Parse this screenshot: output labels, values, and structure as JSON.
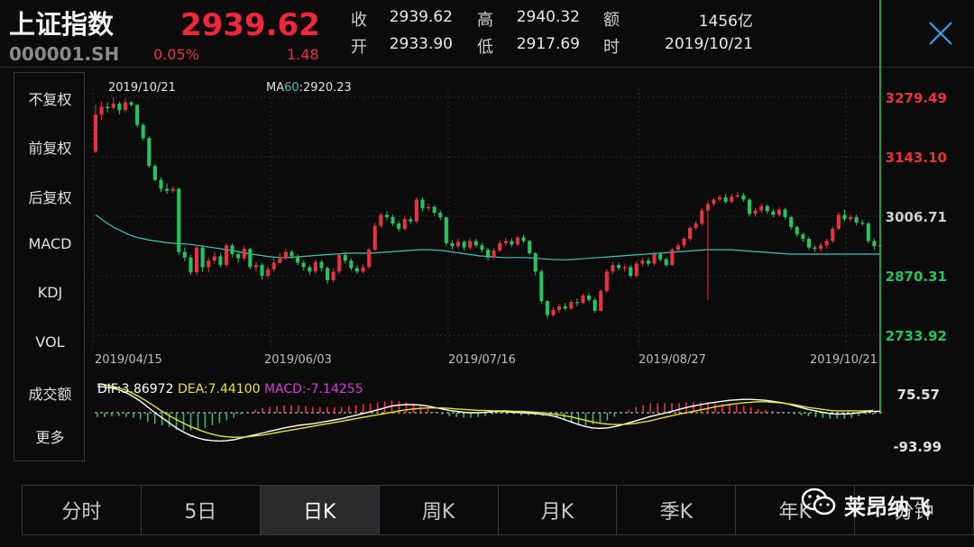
{
  "header": {
    "name": "上证指数",
    "code": "000001.SH",
    "price": "2939.62",
    "change_pct": "0.05%",
    "change": "1.48",
    "quotes": [
      {
        "label": "收",
        "value": "2939.62"
      },
      {
        "label": "高",
        "value": "2940.32"
      },
      {
        "label": "额",
        "value": "1456亿"
      },
      {
        "label": "开",
        "value": "2933.90"
      },
      {
        "label": "低",
        "value": "2917.69"
      },
      {
        "label": "时",
        "value": "2019/10/21"
      }
    ]
  },
  "sidebar": {
    "items": [
      {
        "label": "不复权",
        "active": true
      },
      {
        "label": "前复权",
        "active": false
      },
      {
        "label": "后复权",
        "active": false
      },
      {
        "label": "MACD",
        "active": true
      },
      {
        "label": "KDJ",
        "active": false
      },
      {
        "label": "VOL",
        "active": false
      },
      {
        "label": "成交额",
        "active": false
      },
      {
        "label": "更多",
        "active": false
      }
    ]
  },
  "tabs": [
    {
      "label": "分时",
      "active": false
    },
    {
      "label": "5日",
      "active": false
    },
    {
      "label": "日K",
      "active": true
    },
    {
      "label": "周K",
      "active": false
    },
    {
      "label": "月K",
      "active": false
    },
    {
      "label": "季K",
      "active": false
    },
    {
      "label": "年K",
      "active": false
    },
    {
      "label": "分钟",
      "active": false
    }
  ],
  "watermark": {
    "text": "莱昂纳飞",
    "icon": "wechat-icon"
  },
  "colors": {
    "up": "#e8333f",
    "down": "#22c55e",
    "ma": "#40c8b8",
    "dif": "#ffffff",
    "dea": "#e6e62a",
    "macd": "#d63cd6",
    "accent": "#3aa0ff"
  },
  "chart_data": [
    {
      "type": "candlestick",
      "title": "",
      "top_left_date": "2019/10/21",
      "ma_label_prefix": "MA",
      "ma_period": "60",
      "ma_value": ":2920.23",
      "y_ticks": [
        "3279.49",
        "3143.10",
        "3006.71",
        "2870.31",
        "2733.92"
      ],
      "ylim": [
        2733.92,
        3279.49
      ],
      "x_ticks": [
        "2019/04/15",
        "2019/06/03",
        "2019/07/16",
        "2019/08/27",
        "2019/10/21"
      ],
      "candles": [
        [
          3155,
          3240,
          3262,
          3152
        ],
        [
          3240,
          3258,
          3270,
          3228
        ],
        [
          3258,
          3255,
          3268,
          3245
        ],
        [
          3255,
          3265,
          3280,
          3252
        ],
        [
          3265,
          3250,
          3270,
          3240
        ],
        [
          3250,
          3268,
          3278,
          3245
        ],
        [
          3268,
          3262,
          3272,
          3258
        ],
        [
          3262,
          3216,
          3264,
          3210
        ],
        [
          3216,
          3186,
          3220,
          3180
        ],
        [
          3186,
          3122,
          3190,
          3118
        ],
        [
          3122,
          3090,
          3126,
          3086
        ],
        [
          3090,
          3070,
          3096,
          3062
        ],
        [
          3070,
          3065,
          3082,
          3058
        ],
        [
          3065,
          3070,
          3076,
          3060
        ],
        [
          3070,
          2925,
          3072,
          2918
        ],
        [
          2925,
          2912,
          2935,
          2904
        ],
        [
          2912,
          2878,
          2918,
          2872
        ],
        [
          2878,
          2935,
          2942,
          2872
        ],
        [
          2935,
          2890,
          2940,
          2880
        ],
        [
          2890,
          2905,
          2912,
          2878
        ],
        [
          2905,
          2915,
          2925,
          2898
        ],
        [
          2915,
          2895,
          2922,
          2890
        ],
        [
          2895,
          2940,
          2945,
          2890
        ],
        [
          2940,
          2920,
          2945,
          2912
        ],
        [
          2920,
          2910,
          2928,
          2900
        ],
        [
          2910,
          2932,
          2940,
          2905
        ],
        [
          2932,
          2890,
          2935,
          2885
        ],
        [
          2890,
          2895,
          2902,
          2880
        ],
        [
          2895,
          2870,
          2900,
          2862
        ],
        [
          2870,
          2885,
          2892,
          2865
        ],
        [
          2885,
          2900,
          2912,
          2880
        ],
        [
          2900,
          2910,
          2922,
          2898
        ],
        [
          2910,
          2925,
          2932,
          2905
        ],
        [
          2925,
          2915,
          2930,
          2908
        ],
        [
          2915,
          2900,
          2920,
          2894
        ],
        [
          2900,
          2890,
          2906,
          2882
        ],
        [
          2890,
          2880,
          2895,
          2872
        ],
        [
          2880,
          2902,
          2908,
          2875
        ],
        [
          2902,
          2888,
          2906,
          2880
        ],
        [
          2888,
          2860,
          2892,
          2852
        ],
        [
          2860,
          2880,
          2888,
          2855
        ],
        [
          2880,
          2918,
          2922,
          2875
        ],
        [
          2918,
          2905,
          2925,
          2898
        ],
        [
          2905,
          2888,
          2910,
          2882
        ],
        [
          2888,
          2880,
          2895,
          2875
        ],
        [
          2880,
          2890,
          2896,
          2876
        ],
        [
          2890,
          2930,
          2935,
          2886
        ],
        [
          2930,
          2985,
          2992,
          2926
        ],
        [
          2985,
          3010,
          3015,
          2980
        ],
        [
          3010,
          3005,
          3018,
          2998
        ],
        [
          3005,
          2990,
          3010,
          2985
        ],
        [
          2990,
          2978,
          2996,
          2972
        ],
        [
          2978,
          3000,
          3008,
          2974
        ],
        [
          3000,
          2995,
          3006,
          2988
        ],
        [
          2995,
          3045,
          3050,
          2990
        ],
        [
          3045,
          3025,
          3050,
          3018
        ],
        [
          3025,
          3028,
          3036,
          3018
        ],
        [
          3028,
          3015,
          3032,
          3008
        ],
        [
          3015,
          3004,
          3020,
          2998
        ],
        [
          3004,
          2945,
          3006,
          2938
        ],
        [
          2945,
          2938,
          2952,
          2930
        ],
        [
          2938,
          2948,
          2955,
          2932
        ],
        [
          2948,
          2935,
          2952,
          2928
        ],
        [
          2935,
          2950,
          2958,
          2930
        ],
        [
          2950,
          2940,
          2955,
          2935
        ],
        [
          2940,
          2930,
          2946,
          2924
        ],
        [
          2930,
          2912,
          2935,
          2905
        ],
        [
          2912,
          2928,
          2934,
          2908
        ],
        [
          2928,
          2945,
          2950,
          2925
        ],
        [
          2945,
          2950,
          2958,
          2940
        ],
        [
          2950,
          2942,
          2956,
          2936
        ],
        [
          2942,
          2958,
          2962,
          2938
        ],
        [
          2958,
          2950,
          2964,
          2945
        ],
        [
          2950,
          2922,
          2953,
          2918
        ],
        [
          2922,
          2880,
          2925,
          2872
        ],
        [
          2880,
          2812,
          2885,
          2805
        ],
        [
          2812,
          2780,
          2815,
          2772
        ],
        [
          2780,
          2792,
          2798,
          2775
        ],
        [
          2792,
          2800,
          2806,
          2785
        ],
        [
          2800,
          2795,
          2808,
          2790
        ],
        [
          2795,
          2810,
          2815,
          2792
        ],
        [
          2810,
          2808,
          2818,
          2800
        ],
        [
          2808,
          2825,
          2830,
          2805
        ],
        [
          2825,
          2815,
          2832,
          2810
        ],
        [
          2815,
          2790,
          2820,
          2785
        ],
        [
          2790,
          2835,
          2840,
          2788
        ],
        [
          2835,
          2880,
          2886,
          2832
        ],
        [
          2880,
          2895,
          2902,
          2875
        ],
        [
          2895,
          2888,
          2900,
          2882
        ],
        [
          2888,
          2890,
          2896,
          2880
        ],
        [
          2890,
          2870,
          2895,
          2865
        ],
        [
          2870,
          2898,
          2904,
          2866
        ],
        [
          2898,
          2905,
          2912,
          2892
        ],
        [
          2905,
          2898,
          2912,
          2892
        ],
        [
          2898,
          2920,
          2926,
          2894
        ],
        [
          2920,
          2908,
          2925,
          2902
        ],
        [
          2908,
          2895,
          2912,
          2890
        ],
        [
          2895,
          2930,
          2935,
          2892
        ],
        [
          2930,
          2940,
          2946,
          2925
        ],
        [
          2940,
          2955,
          2960,
          2935
        ],
        [
          2955,
          2980,
          2985,
          2950
        ],
        [
          2980,
          2990,
          2996,
          2975
        ],
        [
          2990,
          3020,
          3026,
          2985
        ],
        [
          3020,
          3035,
          3042,
          2815
        ],
        [
          3035,
          3045,
          3050,
          3030
        ],
        [
          3045,
          3050,
          3056,
          3040
        ],
        [
          3050,
          3040,
          3058,
          3036
        ],
        [
          3040,
          3052,
          3058,
          3036
        ],
        [
          3052,
          3055,
          3062,
          3048
        ],
        [
          3055,
          3045,
          3060,
          3040
        ],
        [
          3045,
          3012,
          3048,
          3006
        ],
        [
          3012,
          3020,
          3026,
          3006
        ],
        [
          3020,
          3030,
          3036,
          3014
        ],
        [
          3030,
          3018,
          3034,
          3012
        ],
        [
          3018,
          3010,
          3024,
          3004
        ],
        [
          3010,
          3022,
          3028,
          3006
        ],
        [
          3022,
          3005,
          3026,
          3000
        ],
        [
          3005,
          2982,
          3008,
          2976
        ],
        [
          2982,
          2965,
          2986,
          2958
        ],
        [
          2965,
          2955,
          2970,
          2948
        ],
        [
          2955,
          2935,
          2960,
          2930
        ],
        [
          2935,
          2932,
          2940,
          2925
        ],
        [
          2932,
          2940,
          2946,
          2925
        ],
        [
          2940,
          2950,
          2955,
          2932
        ],
        [
          2950,
          2978,
          2984,
          2946
        ],
        [
          2978,
          3010,
          3016,
          2974
        ],
        [
          3010,
          3000,
          3022,
          2995
        ],
        [
          3000,
          3005,
          3010,
          2994
        ],
        [
          3005,
          2992,
          3010,
          2986
        ],
        [
          2992,
          2990,
          2998,
          2985
        ],
        [
          2990,
          2950,
          2994,
          2944
        ],
        [
          2950,
          2938,
          2956,
          2930
        ],
        [
          2938,
          2940,
          2948,
          2932
        ]
      ],
      "ma": [
        3010,
        3000,
        2990,
        2982,
        2975,
        2968,
        2962,
        2958,
        2955,
        2952,
        2950,
        2948,
        2946,
        2945,
        2944,
        2943,
        2942,
        2940,
        2938,
        2936,
        2934,
        2932,
        2930,
        2928,
        2925,
        2922,
        2920,
        2918,
        2916,
        2914,
        2913,
        2912,
        2912,
        2913,
        2914,
        2915,
        2916,
        2917,
        2918,
        2919,
        2920,
        2921,
        2922,
        2922,
        2922,
        2922,
        2922,
        2923,
        2924,
        2925,
        2926,
        2927,
        2928,
        2929,
        2930,
        2930,
        2930,
        2929,
        2928,
        2926,
        2924,
        2922,
        2920,
        2918,
        2916,
        2915,
        2914,
        2913,
        2912,
        2912,
        2912,
        2912,
        2912,
        2911,
        2910,
        2909,
        2908,
        2907,
        2907,
        2907,
        2908,
        2909,
        2910,
        2911,
        2912,
        2913,
        2914,
        2915,
        2916,
        2917,
        2918,
        2919,
        2920,
        2921,
        2922,
        2923,
        2924,
        2925,
        2926,
        2927,
        2928,
        2929,
        2930,
        2930,
        2930,
        2930,
        2930,
        2929,
        2928,
        2927,
        2926,
        2925,
        2924,
        2923,
        2922,
        2921,
        2920,
        2920,
        2920,
        2920,
        2920,
        2920,
        2920,
        2920,
        2920,
        2920,
        2920,
        2920,
        2920,
        2920,
        2920,
        2920
      ],
      "ma_color": "#40c8b8"
    },
    {
      "type": "macd",
      "dif_label": "DIF:3.86972",
      "dea_label": "DEA:7.44100",
      "macd_label": "MACD:-7.14255",
      "y_ticks": [
        "75.57",
        "-93.99"
      ],
      "ylim": [
        -93.99,
        75.57
      ],
      "dif": [
        55,
        54,
        52,
        48,
        42,
        34,
        24,
        12,
        0,
        -12,
        -24,
        -36,
        -46,
        -54,
        -60,
        -64,
        -66,
        -67,
        -66,
        -64,
        -60,
        -56,
        -52,
        -48,
        -44,
        -40,
        -36,
        -33,
        -30,
        -28,
        -26,
        -23,
        -20,
        -17,
        -14,
        -10,
        -6,
        -2,
        2,
        6,
        10,
        14,
        16,
        17,
        17,
        16,
        14,
        11,
        8,
        5,
        3,
        1,
        0,
        0,
        1,
        2,
        3,
        2,
        1,
        0,
        -1,
        -2,
        -4,
        -6,
        -10,
        -16,
        -22,
        -28,
        -33,
        -36,
        -37,
        -36,
        -33,
        -29,
        -24,
        -19,
        -14,
        -9,
        -5,
        -1,
        3,
        7,
        11,
        14,
        17,
        20,
        22,
        24,
        26,
        27,
        28,
        28,
        27,
        26,
        24,
        22,
        19,
        15,
        11,
        7,
        4,
        1,
        -2,
        -3,
        -3,
        -2,
        0,
        2,
        3,
        3
      ],
      "dea": [
        60,
        59,
        56,
        52,
        47,
        40,
        32,
        23,
        13,
        3,
        -7,
        -16,
        -25,
        -33,
        -40,
        -46,
        -51,
        -55,
        -57,
        -58,
        -58,
        -57,
        -55,
        -53,
        -50,
        -47,
        -44,
        -41,
        -38,
        -35,
        -32,
        -29,
        -26,
        -23,
        -20,
        -17,
        -14,
        -11,
        -8,
        -5,
        -2,
        1,
        4,
        6,
        8,
        9,
        10,
        10,
        10,
        9,
        8,
        7,
        6,
        5,
        5,
        4,
        4,
        4,
        3,
        3,
        2,
        1,
        0,
        -2,
        -4,
        -7,
        -10,
        -14,
        -18,
        -22,
        -25,
        -27,
        -28,
        -28,
        -27,
        -25,
        -22,
        -19,
        -15,
        -11,
        -7,
        -3,
        0,
        3,
        6,
        9,
        12,
        15,
        17,
        19,
        21,
        22,
        23,
        23,
        22,
        21,
        19,
        17,
        14,
        11,
        9,
        7,
        5,
        4,
        4,
        4,
        4,
        4,
        5
      ]
    }
  ]
}
